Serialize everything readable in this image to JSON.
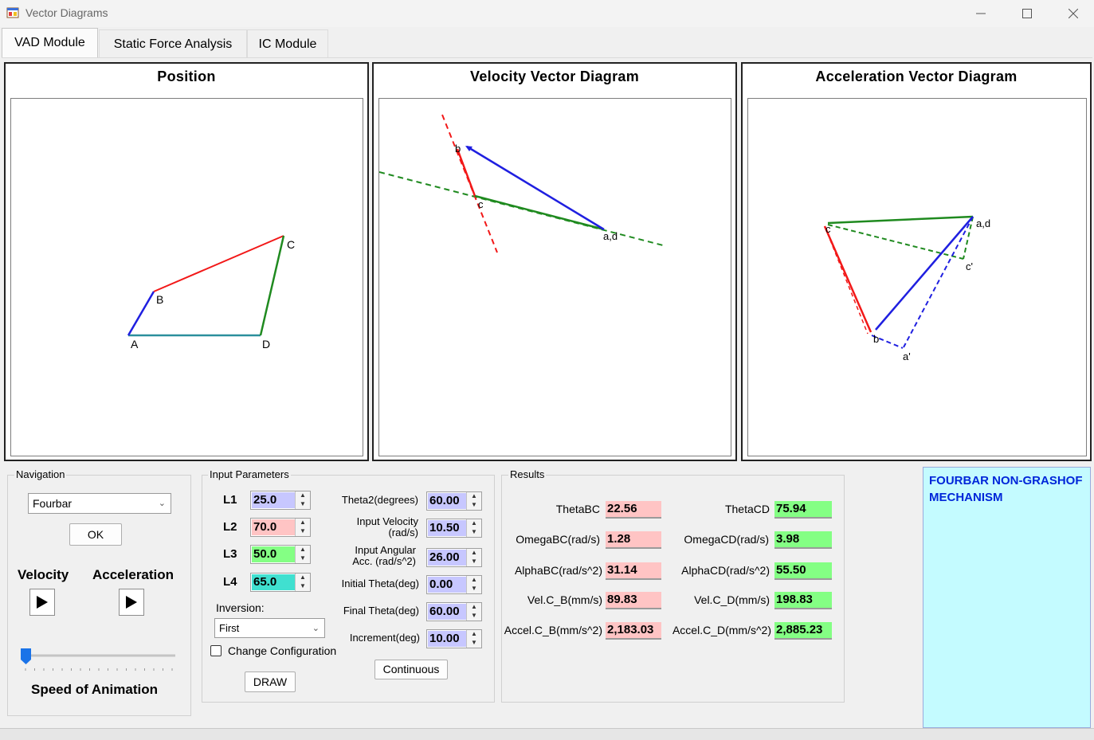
{
  "window": {
    "title": "Vector Diagrams"
  },
  "tabs": [
    {
      "label": "VAD Module"
    },
    {
      "label": "Static Force Analysis"
    },
    {
      "label": "IC Module"
    }
  ],
  "panels": {
    "position": {
      "title": "Position",
      "points": {
        "A": "A",
        "B": "B",
        "C": "C",
        "D": "D"
      }
    },
    "velocity": {
      "title": "Velocity Vector Diagram",
      "points": {
        "b": "b",
        "c": "c",
        "ad": "a,d"
      }
    },
    "acceleration": {
      "title": "Acceleration Vector Diagram",
      "points": {
        "ad": "a,d",
        "c": "c",
        "cprime": "c'",
        "b": "b",
        "aprime": "a'"
      }
    }
  },
  "navigation": {
    "group_label": "Navigation",
    "mechanism": "Fourbar",
    "ok_label": "OK",
    "velocity_label": "Velocity",
    "acceleration_label": "Acceleration",
    "speed_label": "Speed of Animation",
    "speed_value": 0
  },
  "input": {
    "group_label": "Input Parameters",
    "links": [
      {
        "label": "L1",
        "value": "25.0",
        "color": "#c7c7ff"
      },
      {
        "label": "L2",
        "value": "70.0",
        "color": "#ffc4c4"
      },
      {
        "label": "L3",
        "value": "50.0",
        "color": "#84ff84"
      },
      {
        "label": "L4",
        "value": "65.0",
        "color": "#40e0d0"
      }
    ],
    "inversion_label": "Inversion:",
    "inversion_value": "First",
    "change_config_label": "Change Configuration",
    "draw_label": "DRAW",
    "theta2_label": "Theta2(degrees)",
    "theta2_value": "60.00",
    "input_velocity_label_1": "Input Velocity",
    "input_velocity_label_2": "(rad/s)",
    "input_velocity_value": "10.50",
    "input_acc_label_1": "Input Angular",
    "input_acc_label_2": "Acc. (rad/s^2)",
    "input_acc_value": "26.00",
    "initial_theta_label": "Initial Theta(deg)",
    "initial_theta_value": "0.00",
    "final_theta_label": "Final Theta(deg)",
    "final_theta_value": "60.00",
    "increment_label": "Increment(deg)",
    "increment_value": "10.00",
    "continuous_label": "Continuous",
    "field_color": "#c7c7ff"
  },
  "results": {
    "group_label": "Results",
    "left": [
      {
        "label": "ThetaBC",
        "value": "22.56"
      },
      {
        "label": "OmegaBC(rad/s)",
        "value": "1.28"
      },
      {
        "label": "AlphaBC(rad/s^2)",
        "value": "31.14"
      },
      {
        "label": "Vel.C_B(mm/s)",
        "value": "89.83"
      },
      {
        "label": "Accel.C_B(mm/s^2)",
        "value": "2,183.03"
      }
    ],
    "right": [
      {
        "label": "ThetaCD",
        "value": "75.94"
      },
      {
        "label": "OmegaCD(rad/s)",
        "value": "3.98"
      },
      {
        "label": "AlphaCD(rad/s^2)",
        "value": "55.50"
      },
      {
        "label": "Vel.C_D(mm/s)",
        "value": "198.83"
      },
      {
        "label": "Accel.C_D(mm/s^2)",
        "value": "2,885.23"
      }
    ],
    "left_color": "#ffc4c4",
    "right_color": "#84ff84"
  },
  "description": {
    "text": "FOURBAR NON-GRASHOF MECHANISM"
  },
  "icons": {
    "app": "app-window-icon",
    "minimize": "minimize-icon",
    "maximize": "maximize-icon",
    "close": "close-icon",
    "play": "play-icon",
    "dropdown": "chevron-down-icon",
    "spin": "spin-arrows-icon"
  }
}
